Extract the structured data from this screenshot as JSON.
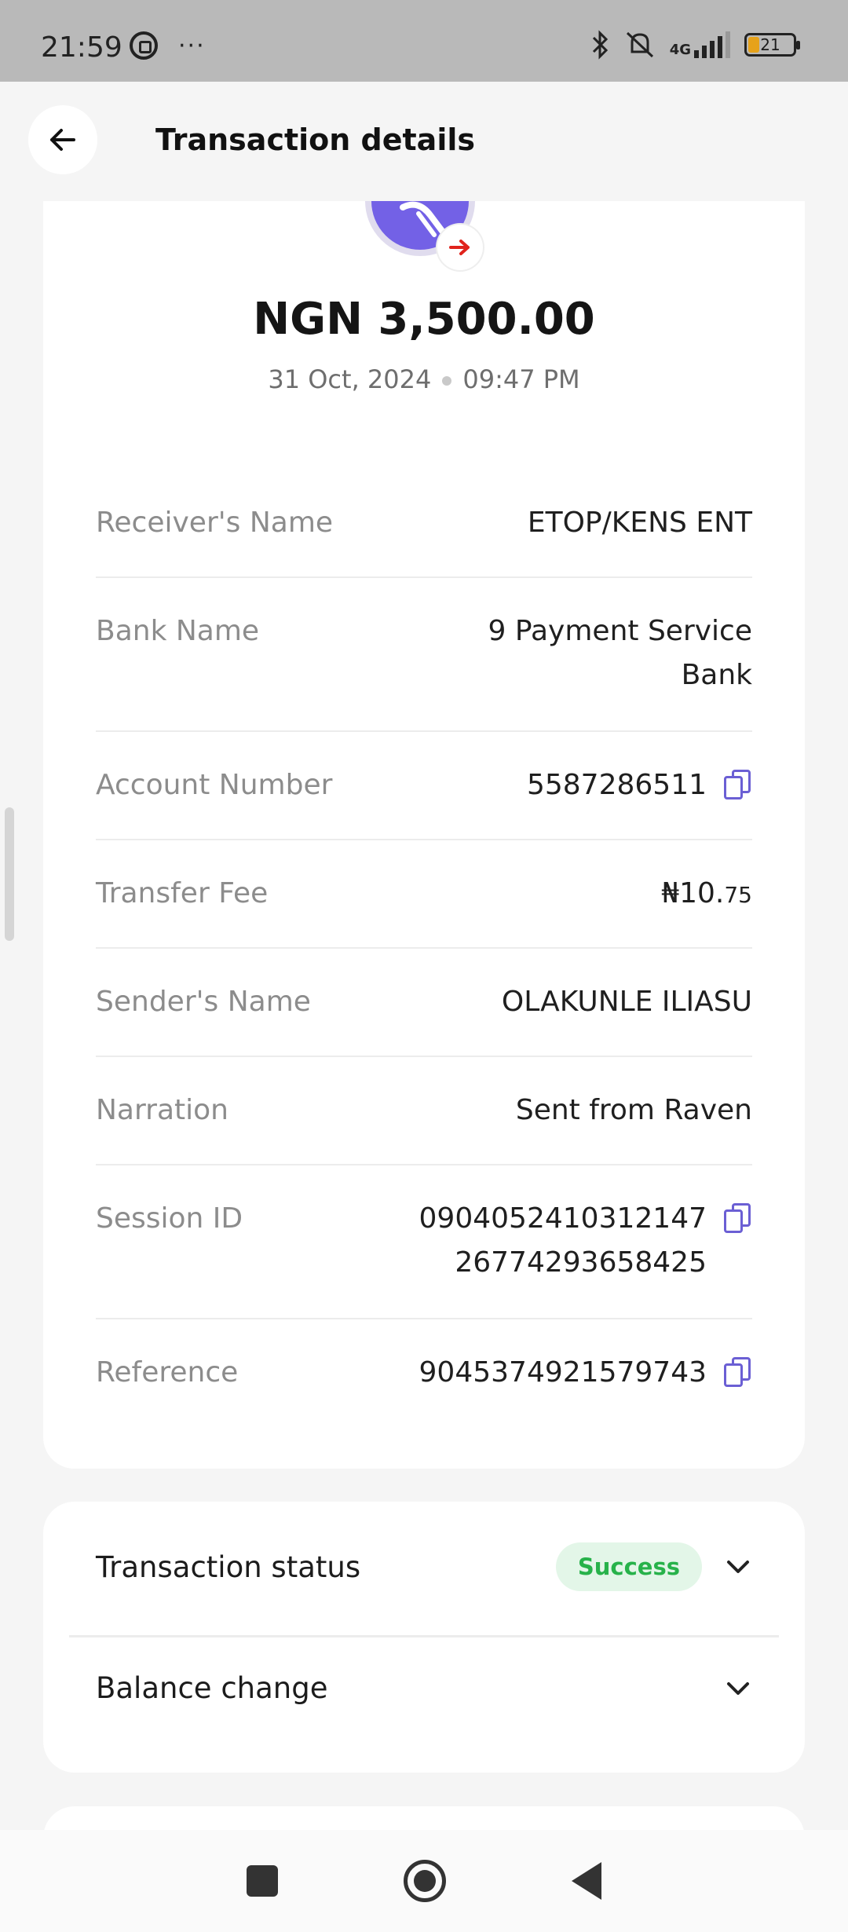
{
  "status_bar": {
    "time": "21:59",
    "more": "···",
    "network": "4G",
    "battery": "21",
    "icons": [
      "whatsapp-icon",
      "bluetooth-icon",
      "mute-icon",
      "signal-icon",
      "battery-icon"
    ]
  },
  "header": {
    "title": "Transaction details",
    "back_icon": "arrow-left-icon"
  },
  "summary": {
    "amount": "NGN 3,500.00",
    "date": "31 Oct, 2024",
    "time": "09:47 PM",
    "avatar_color": "#7361e6",
    "direction_icon": "arrow-right-icon"
  },
  "details": [
    {
      "label": "Receiver's Name",
      "value": "ETOP/KENS ENT"
    },
    {
      "label": "Bank Name",
      "value": "9 Payment Service",
      "value2": "Bank"
    },
    {
      "label": "Account Number",
      "value": "5587286511"
    },
    {
      "label": "Transfer Fee",
      "value": "₦10.",
      "value_small": "75"
    },
    {
      "label": "Sender's Name",
      "value": "OLAKUNLE ILIASU"
    },
    {
      "label": "Narration",
      "value": "Sent from Raven"
    },
    {
      "label": "Session ID",
      "value": "0904052410312147",
      "value2": "26774293658425"
    },
    {
      "label": "Reference",
      "value": "9045374921579743"
    }
  ],
  "status_section": {
    "status_label": "Transaction status",
    "status_badge": "Success",
    "balance_label": "Balance change",
    "success_color": "#27b24a"
  },
  "colors": {
    "accent": "#6b5fd4",
    "danger": "#e0231c"
  }
}
